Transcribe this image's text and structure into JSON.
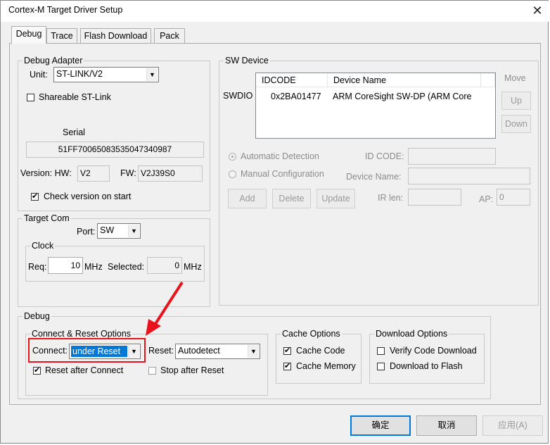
{
  "window": {
    "title": "Cortex-M Target Driver Setup",
    "close_glyph": "✕"
  },
  "tabs": [
    {
      "label": "Debug",
      "active": true
    },
    {
      "label": "Trace"
    },
    {
      "label": "Flash Download"
    },
    {
      "label": "Pack"
    }
  ],
  "debug_adapter": {
    "legend": "Debug Adapter",
    "unit_label": "Unit:",
    "unit_value": "ST-LINK/V2",
    "shareable_label": "Shareable ST-Link",
    "shareable_checked": false,
    "serial_label": "Serial",
    "serial_value": "51FF70065083535047340987",
    "version_label": "Version: HW:",
    "hw_value": "V2",
    "fw_label": "FW:",
    "fw_value": "V2J39S0",
    "check_version_label": "Check version on start",
    "check_version_checked": true
  },
  "target_com": {
    "legend": "Target Com",
    "port_label": "Port:",
    "port_value": "SW",
    "clock_legend": "Clock",
    "req_label": "Req:",
    "req_value": "10",
    "req_unit": "MHz",
    "selected_label": "Selected:",
    "selected_value": "0",
    "selected_unit": "MHz"
  },
  "sw_device": {
    "legend": "SW Device",
    "row_label": "SWDIO",
    "columns": [
      "IDCODE",
      "Device Name"
    ],
    "rows": [
      {
        "idcode": "0x2BA01477",
        "device_name": "ARM CoreSight SW-DP (ARM Core"
      }
    ],
    "move_label": "Move",
    "up_label": "Up",
    "down_label": "Down",
    "auto_detect_label": "Automatic Detection",
    "auto_detect_selected": true,
    "manual_config_label": "Manual Configuration",
    "id_code_label": "ID CODE:",
    "device_name_label": "Device Name:",
    "ir_len_label": "IR len:",
    "ap_label": "AP:",
    "ap_value": "0",
    "add_label": "Add",
    "delete_label": "Delete",
    "update_label": "Update"
  },
  "debug_section": {
    "legend": "Debug",
    "connect_reset": {
      "legend": "Connect & Reset Options",
      "connect_label": "Connect:",
      "connect_value": "under Reset",
      "reset_label": "Reset:",
      "reset_value": "Autodetect",
      "reset_after_connect_label": "Reset after Connect",
      "reset_after_connect_checked": true,
      "stop_after_reset_label": "Stop after Reset",
      "stop_after_reset_checked": false
    },
    "cache_options": {
      "legend": "Cache Options",
      "cache_code_label": "Cache Code",
      "cache_code_checked": true,
      "cache_memory_label": "Cache Memory",
      "cache_memory_checked": true
    },
    "download_options": {
      "legend": "Download Options",
      "verify_label": "Verify Code Download",
      "verify_checked": false,
      "download_flash_label": "Download to Flash",
      "download_flash_checked": false
    }
  },
  "footer": {
    "ok_label": "确定",
    "cancel_label": "取消",
    "apply_label": "应用(A)"
  },
  "annotation": {
    "highlight_color": "#e8141b"
  },
  "glyphs": {
    "check": "✔",
    "dropdown": "▼"
  }
}
